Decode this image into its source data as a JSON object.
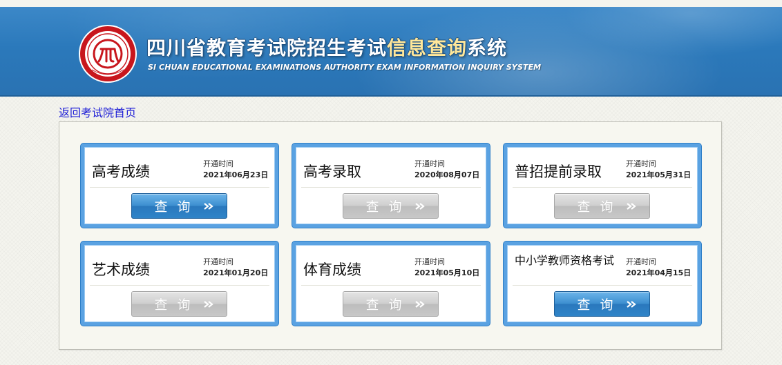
{
  "header": {
    "logo_icon": "sichuan-education-exam-authority-seal",
    "title_part1": "四川省教育考试院招生考试",
    "title_highlight": "信息查询",
    "title_part2": "系统",
    "subtitle_en": "SI CHUAN EDUCATIONAL EXAMINATIONS AUTHORITY EXAM INFORMATION INQUIRY SYSTEM"
  },
  "back_link": "返回考试院首页",
  "colors": {
    "header_blue": "#2b79bb",
    "highlight_gold": "#ffe79a",
    "active_button": "#3d8fd0",
    "disabled_button": "#c8c8c8",
    "link": "#1a1ad6"
  },
  "cards": [
    {
      "name": "高考成绩",
      "open_label": "开通时间",
      "open_date": "2021年06月23日",
      "button": "查询",
      "enabled": true
    },
    {
      "name": "高考录取",
      "open_label": "开通时间",
      "open_date": "2020年08月07日",
      "button": "查询",
      "enabled": false
    },
    {
      "name": "普招提前录取",
      "open_label": "开通时间",
      "open_date": "2021年05月31日",
      "button": "查询",
      "enabled": false
    },
    {
      "name": "艺术成绩",
      "open_label": "开通时间",
      "open_date": "2021年01月20日",
      "button": "查询",
      "enabled": false
    },
    {
      "name": "体育成绩",
      "open_label": "开通时间",
      "open_date": "2021年05月10日",
      "button": "查询",
      "enabled": false
    },
    {
      "name": "中小学教师资格考试",
      "open_label": "开通时间",
      "open_date": "2021年04月15日",
      "button": "查询",
      "enabled": true
    }
  ]
}
